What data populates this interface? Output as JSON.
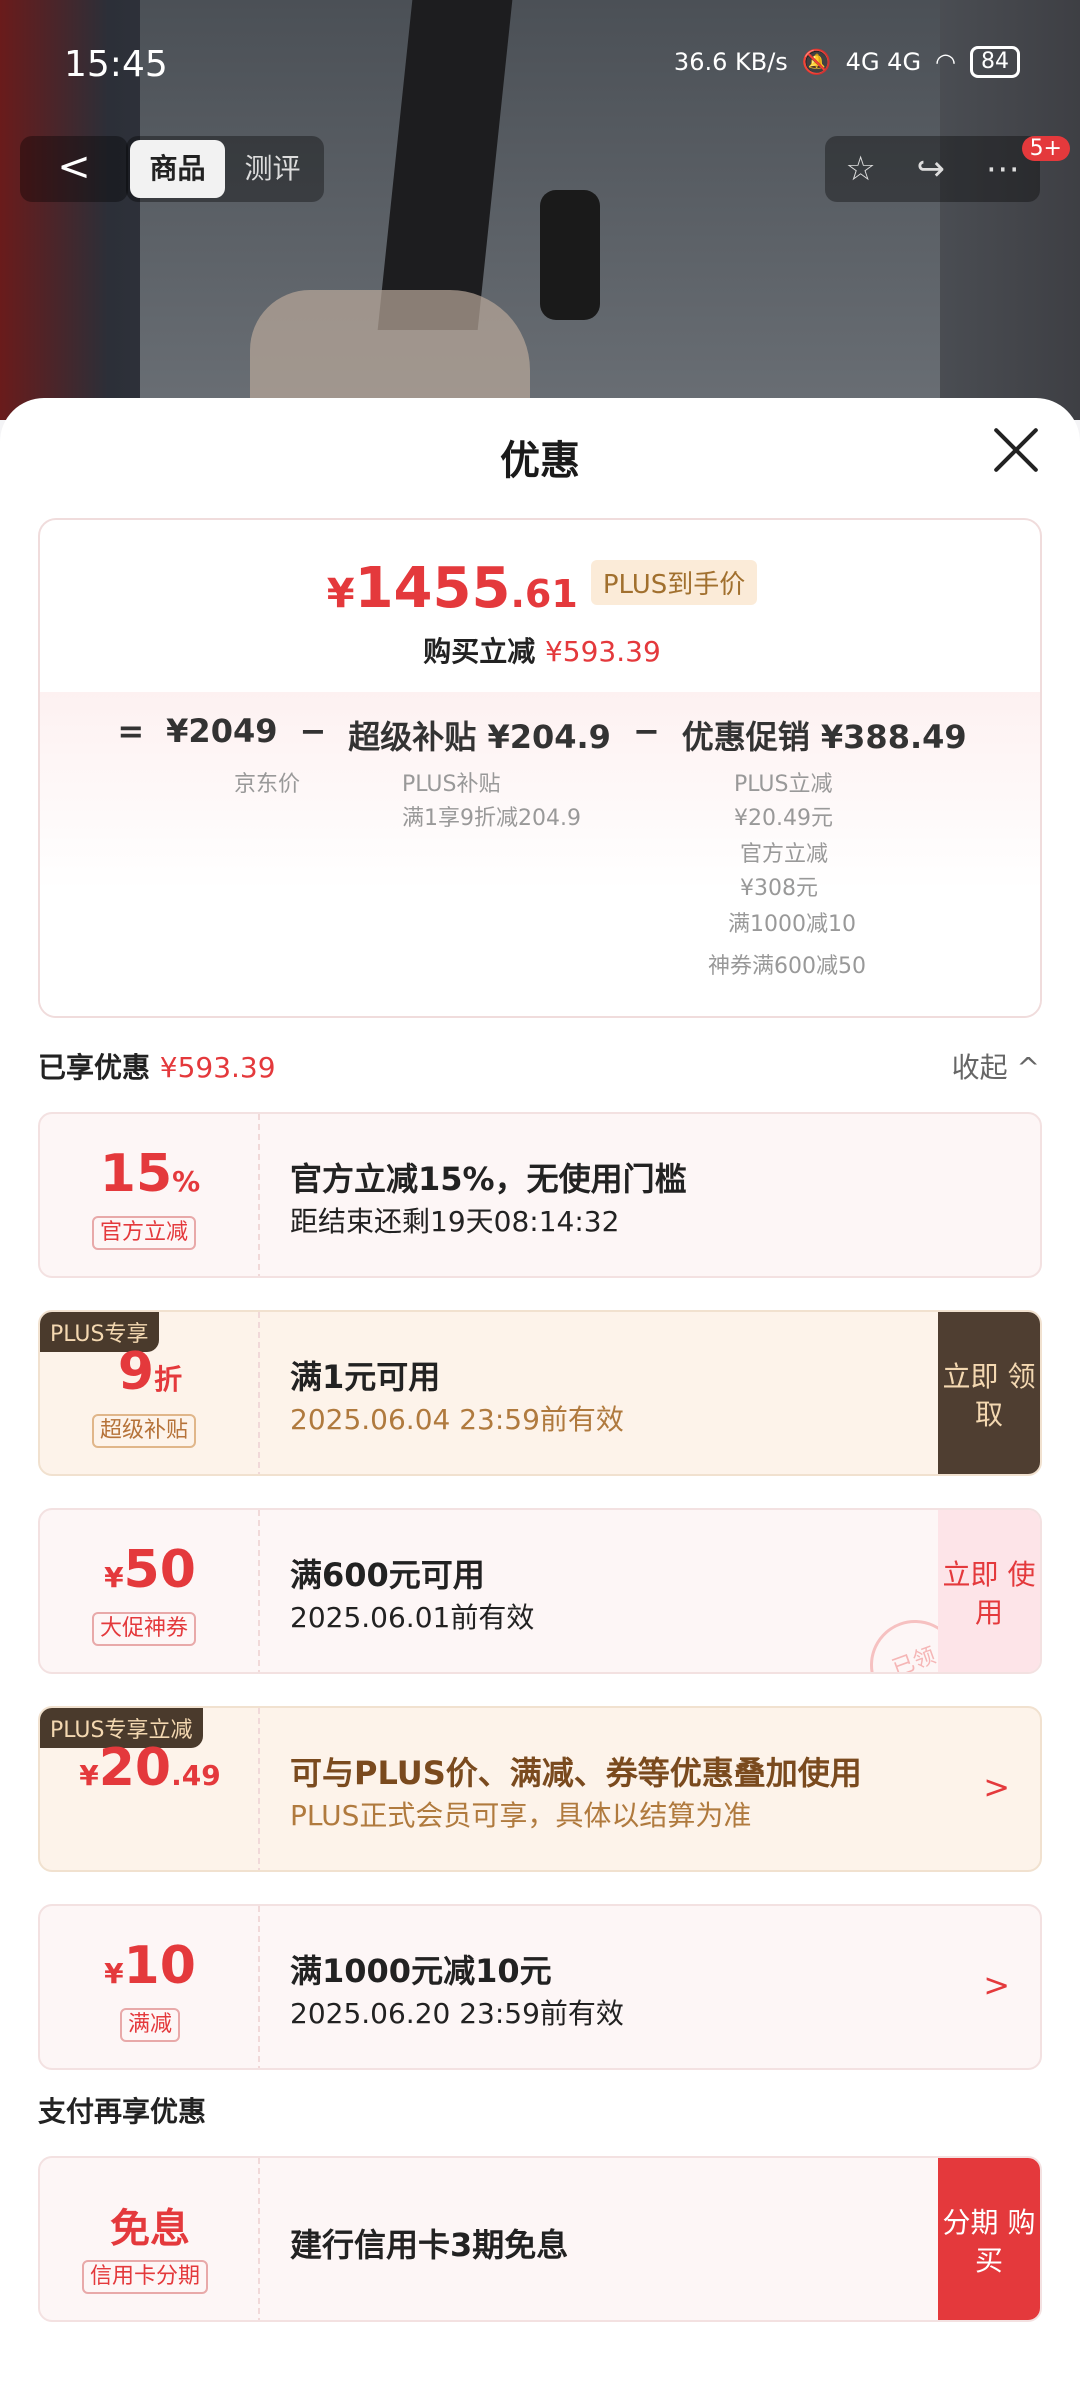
{
  "status": {
    "time": "15:45",
    "net": "36.6 KB/s",
    "signal": "4G 4G",
    "battery": "84"
  },
  "nav": {
    "back": "<",
    "tab_product": "商品",
    "tab_review": "测评",
    "badge": "5+"
  },
  "sheet": {
    "title": "优惠"
  },
  "summary": {
    "currency": "¥",
    "price_int": "1455",
    "price_dec": ".61",
    "plus_tag": "PLUS到手价",
    "buy_label": "购买立减",
    "buy_amount": "¥593.39",
    "eq_sign": "=",
    "jd_price": "¥2049",
    "minus1": "−",
    "subsidy": "超级补贴 ¥204.9",
    "minus2": "−",
    "promo": "优惠促销 ¥388.49",
    "jd_label": "京东价",
    "plus_sub_title": "PLUS补贴",
    "plus_sub_desc": "满1享9折减204.9",
    "plus_instant": "PLUS立减",
    "plus_instant_amt": "¥20.49元",
    "official_instant": "官方立减",
    "official_instant_amt": "¥308元",
    "full_reduce": "满1000减10",
    "coupon": "神券满600减50"
  },
  "enjoyed": {
    "label": "已享优惠",
    "amount": "¥593.39",
    "collapse": "收起 ^"
  },
  "cards": [
    {
      "value": "15",
      "unit": "%",
      "label": "官方立减",
      "line1": "官方立减15%，无使用门槛",
      "line2": "距结束还剩19天08:14:32"
    },
    {
      "tag": "PLUS专享",
      "value": "9",
      "unit": "折",
      "label": "超级补贴",
      "line1": "满1元可用",
      "line2": "2025.06.04 23:59前有效",
      "action": "立即 领取"
    },
    {
      "value": "50",
      "prefix": "¥",
      "label": "大促神券",
      "line1": "满600元可用",
      "line2": "2025.06.01前有效",
      "action": "立即 使用",
      "stamp": "已领"
    },
    {
      "tag": "PLUS专享立减",
      "prefix": "¥",
      "value": "20",
      "unit": ".49",
      "line1": "可与PLUS价、满减、券等优惠叠加使用",
      "line2": "PLUS正式会员可享，具体以结算为准",
      "chev": ">"
    },
    {
      "prefix": "¥",
      "value": "10",
      "label": "满减",
      "line1": "满1000元减10元",
      "line2": "2025.06.20 23:59前有效",
      "chev": ">"
    }
  ],
  "pay": {
    "heading": "支付再享优惠",
    "value": "免息",
    "label": "信用卡分期",
    "line1": "建行信用卡3期免息",
    "action": "分期 购买"
  }
}
